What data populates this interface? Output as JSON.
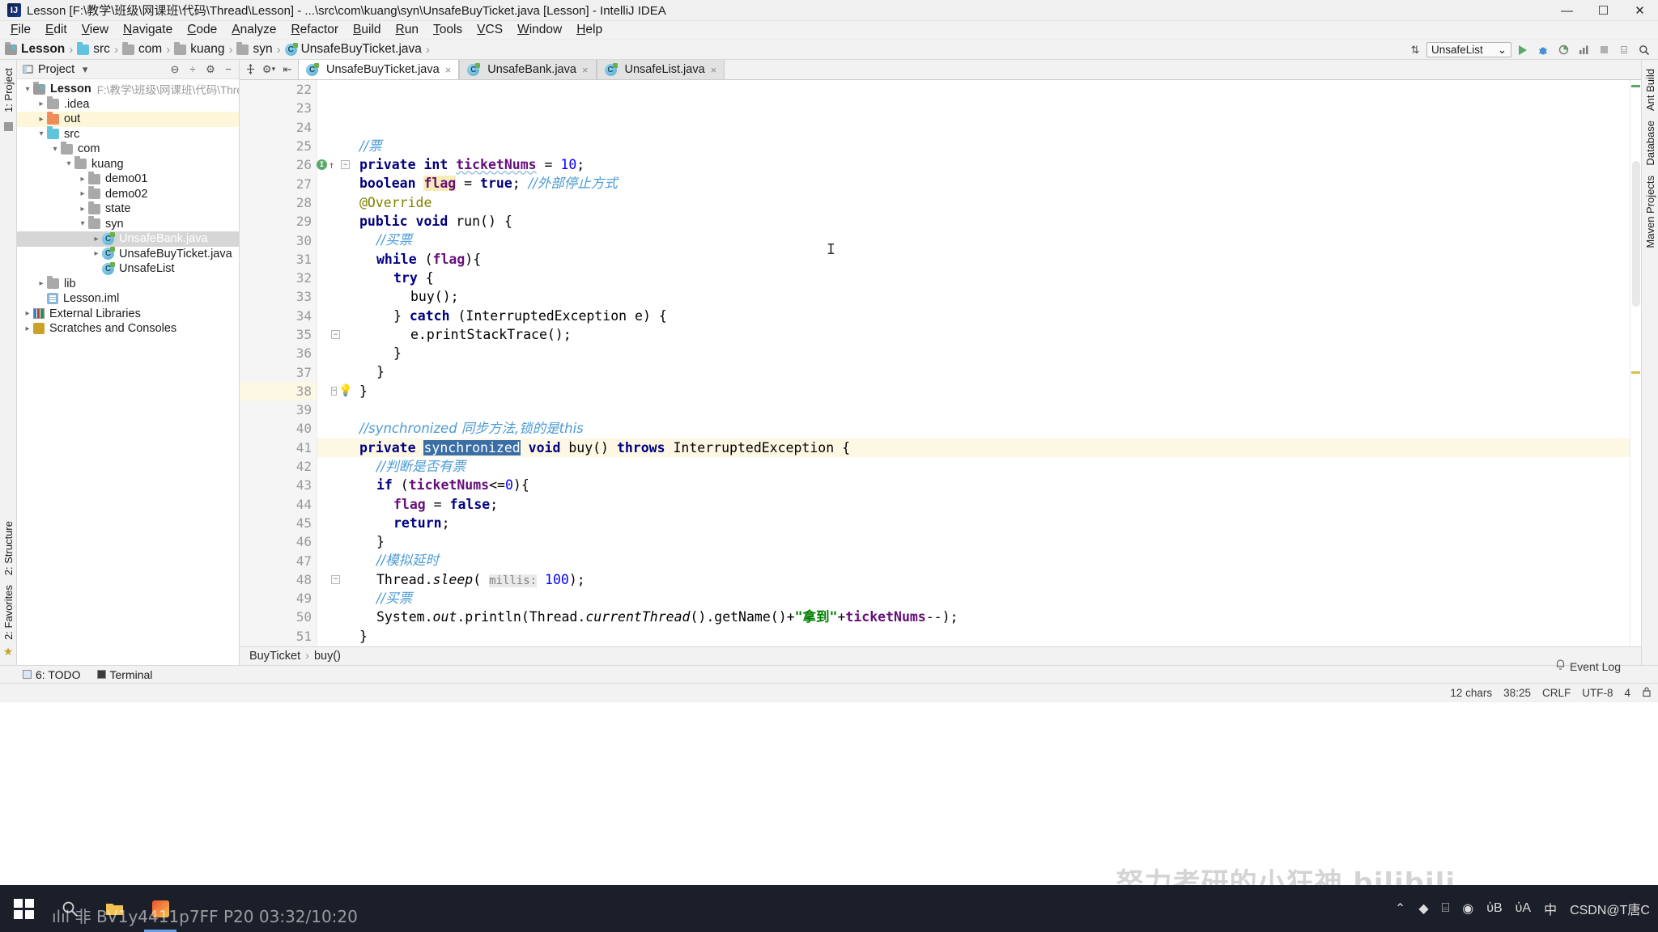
{
  "window": {
    "title": "Lesson [F:\\教学\\班级\\网课班\\代码\\Thread\\Lesson] - ...\\src\\com\\kuang\\syn\\UnsafeBuyTicket.java [Lesson] - IntelliJ IDEA",
    "logo_text": "IJ",
    "minimize": "—",
    "maximize": "☐",
    "close": "✕"
  },
  "menu": {
    "items": [
      "File",
      "Edit",
      "View",
      "Navigate",
      "Code",
      "Analyze",
      "Refactor",
      "Build",
      "Run",
      "Tools",
      "VCS",
      "Window",
      "Help"
    ]
  },
  "breadcrumb": {
    "items": [
      {
        "label": "Lesson",
        "icon": "module-icon"
      },
      {
        "label": "src",
        "icon": "source-folder-icon"
      },
      {
        "label": "com",
        "icon": "package-folder-icon"
      },
      {
        "label": "kuang",
        "icon": "package-folder-icon"
      },
      {
        "label": "syn",
        "icon": "package-folder-icon"
      },
      {
        "label": "UnsafeBuyTicket.java",
        "icon": "java-class-icon"
      }
    ],
    "separator": "›"
  },
  "nav_right": {
    "run_config": "UnsafeList",
    "dropdown_caret": "⌄",
    "update_icon": "⇅",
    "run_icon": "run-icon",
    "debug_icon": "⁂",
    "coverage_icon": "▶",
    "profiler_icon": "▦",
    "stop_icon": "■",
    "layout_icon": "⌸",
    "search_icon": "⌕"
  },
  "left_strip": {
    "project_tab": "1: Project",
    "structure_tab": "2: Structure",
    "favorites_tab": "2: Favorites"
  },
  "right_strip": {
    "ant_tab": "Ant Build",
    "database_tab": "Database",
    "maven_tab": "Maven Projects"
  },
  "project_panel": {
    "title": "Project",
    "caret": "▾",
    "collapse_icon": "⊖",
    "settings_icon": "⚙",
    "expand_icon": "÷",
    "hide_icon": "−",
    "tree": [
      {
        "label": "Lesson",
        "path": "F:\\教学\\班级\\网课班\\代码\\Thread\\Lesson",
        "depth": 0,
        "arrow": "open",
        "icon": "module-icon",
        "bold": true,
        "state": "normal"
      },
      {
        "label": ".idea",
        "depth": 1,
        "arrow": "closed",
        "icon": "folder-icon",
        "state": "normal"
      },
      {
        "label": "out",
        "depth": 1,
        "arrow": "closed",
        "icon": "out-folder-icon",
        "state": "highlight"
      },
      {
        "label": "src",
        "depth": 1,
        "arrow": "open",
        "icon": "source-folder-icon",
        "state": "normal"
      },
      {
        "label": "com",
        "depth": 2,
        "arrow": "open",
        "icon": "package-folder-icon",
        "state": "normal"
      },
      {
        "label": "kuang",
        "depth": 3,
        "arrow": "open",
        "icon": "package-folder-icon",
        "state": "normal"
      },
      {
        "label": "demo01",
        "depth": 4,
        "arrow": "closed",
        "icon": "package-folder-icon",
        "state": "normal"
      },
      {
        "label": "demo02",
        "depth": 4,
        "arrow": "closed",
        "icon": "package-folder-icon",
        "state": "normal"
      },
      {
        "label": "state",
        "depth": 4,
        "arrow": "closed",
        "icon": "package-folder-icon",
        "state": "normal"
      },
      {
        "label": "syn",
        "depth": 4,
        "arrow": "open",
        "icon": "package-folder-icon",
        "state": "normal"
      },
      {
        "label": "UnsafeBank.java",
        "depth": 5,
        "arrow": "closed",
        "icon": "java-class-icon",
        "state": "selected"
      },
      {
        "label": "UnsafeBuyTicket.java",
        "depth": 5,
        "arrow": "closed",
        "icon": "java-class-icon",
        "state": "normal"
      },
      {
        "label": "UnsafeList",
        "depth": 5,
        "arrow": "none",
        "icon": "java-class-icon",
        "state": "normal"
      },
      {
        "label": "lib",
        "depth": 1,
        "arrow": "closed",
        "icon": "folder-icon",
        "state": "normal"
      },
      {
        "label": "Lesson.iml",
        "depth": 1,
        "arrow": "none",
        "icon": "iml-icon",
        "state": "normal"
      },
      {
        "label": "External Libraries",
        "depth": 0,
        "arrow": "closed",
        "icon": "library-icon",
        "state": "normal"
      },
      {
        "label": "Scratches and Consoles",
        "depth": 0,
        "arrow": "closed",
        "icon": "scratch-icon",
        "state": "normal"
      }
    ]
  },
  "editor": {
    "tools": [
      "✢",
      "⚙",
      "⇤"
    ],
    "tabs": [
      {
        "label": "UnsafeBuyTicket.java",
        "active": true,
        "close": "×"
      },
      {
        "label": "UnsafeBank.java",
        "active": false,
        "close": "×"
      },
      {
        "label": "UnsafeList.java",
        "active": false,
        "close": "×"
      }
    ],
    "first_line_number": 22,
    "current_line": 38,
    "lines": [
      {
        "n": 22,
        "indent": 2,
        "tokens": [
          {
            "t": "//票",
            "c": "cmtc"
          }
        ]
      },
      {
        "n": 23,
        "indent": 2,
        "tokens": [
          {
            "t": "private",
            "c": "kw"
          },
          {
            "t": " ",
            "c": "plain"
          },
          {
            "t": "int",
            "c": "kw"
          },
          {
            "t": " ",
            "c": "plain"
          },
          {
            "t": "ticketNums",
            "c": "fld-wavy"
          },
          {
            "t": " = ",
            "c": "plain"
          },
          {
            "t": "10",
            "c": "num"
          },
          {
            "t": ";",
            "c": "plain"
          }
        ]
      },
      {
        "n": 24,
        "indent": 2,
        "tokens": [
          {
            "t": "boolean",
            "c": "kw"
          },
          {
            "t": " ",
            "c": "plain"
          },
          {
            "t": "flag",
            "c": "fld-hl"
          },
          {
            "t": " = ",
            "c": "plain"
          },
          {
            "t": "true",
            "c": "kw"
          },
          {
            "t": "; ",
            "c": "plain"
          },
          {
            "t": "//外部停止方式",
            "c": "cmtc"
          }
        ]
      },
      {
        "n": 25,
        "indent": 2,
        "tokens": [
          {
            "t": "@Override",
            "c": "ann"
          }
        ]
      },
      {
        "n": 26,
        "indent": 2,
        "tokens": [
          {
            "t": "public",
            "c": "kw"
          },
          {
            "t": " ",
            "c": "plain"
          },
          {
            "t": "void",
            "c": "kw"
          },
          {
            "t": " run() {",
            "c": "plain"
          }
        ],
        "mark": "run-gutter"
      },
      {
        "n": 27,
        "indent": 3,
        "tokens": [
          {
            "t": "//买票",
            "c": "cmtc"
          }
        ]
      },
      {
        "n": 28,
        "indent": 3,
        "tokens": [
          {
            "t": "while",
            "c": "kw"
          },
          {
            "t": " (",
            "c": "plain"
          },
          {
            "t": "flag",
            "c": "fld"
          },
          {
            "t": "){",
            "c": "plain"
          }
        ]
      },
      {
        "n": 29,
        "indent": 4,
        "tokens": [
          {
            "t": "try",
            "c": "kw"
          },
          {
            "t": " {",
            "c": "plain"
          }
        ]
      },
      {
        "n": 30,
        "indent": 5,
        "tokens": [
          {
            "t": "buy();",
            "c": "plain"
          }
        ]
      },
      {
        "n": 31,
        "indent": 4,
        "tokens": [
          {
            "t": "} ",
            "c": "plain"
          },
          {
            "t": "catch",
            "c": "kw"
          },
          {
            "t": " (InterruptedException e) {",
            "c": "plain"
          }
        ]
      },
      {
        "n": 32,
        "indent": 5,
        "tokens": [
          {
            "t": "e.printStackTrace();",
            "c": "plain"
          }
        ]
      },
      {
        "n": 33,
        "indent": 4,
        "tokens": [
          {
            "t": "}",
            "c": "plain"
          }
        ]
      },
      {
        "n": 34,
        "indent": 3,
        "tokens": [
          {
            "t": "}",
            "c": "plain"
          }
        ]
      },
      {
        "n": 35,
        "indent": 2,
        "tokens": [
          {
            "t": "}",
            "c": "plain"
          }
        ],
        "fold": true
      },
      {
        "n": 36,
        "indent": 0,
        "tokens": []
      },
      {
        "n": 37,
        "indent": 2,
        "tokens": [
          {
            "t": "//synchronized 同步方法,锁的是this",
            "c": "cmtc"
          }
        ]
      },
      {
        "n": 38,
        "indent": 2,
        "tokens": [
          {
            "t": "private",
            "c": "kw"
          },
          {
            "t": " ",
            "c": "plain"
          },
          {
            "t": "synchronized",
            "c": "sel"
          },
          {
            "t": " ",
            "c": "plain"
          },
          {
            "t": "void",
            "c": "kw"
          },
          {
            "t": " buy() ",
            "c": "plain"
          },
          {
            "t": "throws",
            "c": "kw"
          },
          {
            "t": " InterruptedException {",
            "c": "plain"
          }
        ],
        "fold": true,
        "bulb": true
      },
      {
        "n": 39,
        "indent": 3,
        "tokens": [
          {
            "t": "//判断是否有票",
            "c": "cmtc"
          }
        ]
      },
      {
        "n": 40,
        "indent": 3,
        "tokens": [
          {
            "t": "if",
            "c": "kw"
          },
          {
            "t": " (",
            "c": "plain"
          },
          {
            "t": "ticketNums",
            "c": "fld"
          },
          {
            "t": "<=",
            "c": "plain"
          },
          {
            "t": "0",
            "c": "num"
          },
          {
            "t": "){",
            "c": "plain"
          }
        ]
      },
      {
        "n": 41,
        "indent": 4,
        "tokens": [
          {
            "t": "flag",
            "c": "fld"
          },
          {
            "t": " = ",
            "c": "plain"
          },
          {
            "t": "false",
            "c": "kw"
          },
          {
            "t": ";",
            "c": "plain"
          }
        ]
      },
      {
        "n": 42,
        "indent": 4,
        "tokens": [
          {
            "t": "return",
            "c": "kw"
          },
          {
            "t": ";",
            "c": "plain"
          }
        ]
      },
      {
        "n": 43,
        "indent": 3,
        "tokens": [
          {
            "t": "}",
            "c": "plain"
          }
        ]
      },
      {
        "n": 44,
        "indent": 3,
        "tokens": [
          {
            "t": "//模拟延时",
            "c": "cmtc"
          }
        ]
      },
      {
        "n": 45,
        "indent": 3,
        "tokens": [
          {
            "t": "Thread.",
            "c": "plain"
          },
          {
            "t": "sleep",
            "c": "stat"
          },
          {
            "t": "( ",
            "c": "plain"
          },
          {
            "t": "millis:",
            "c": "param"
          },
          {
            "t": " ",
            "c": "plain"
          },
          {
            "t": "100",
            "c": "num"
          },
          {
            "t": ");",
            "c": "plain"
          }
        ]
      },
      {
        "n": 46,
        "indent": 3,
        "tokens": [
          {
            "t": "//买票",
            "c": "cmtc"
          }
        ]
      },
      {
        "n": 47,
        "indent": 3,
        "tokens": [
          {
            "t": "System.",
            "c": "plain"
          },
          {
            "t": "out",
            "c": "stat"
          },
          {
            "t": ".println(Thread.",
            "c": "plain"
          },
          {
            "t": "currentThread",
            "c": "stat"
          },
          {
            "t": "().getName()+",
            "c": "plain"
          },
          {
            "t": "\"拿到\"",
            "c": "str"
          },
          {
            "t": "+",
            "c": "plain"
          },
          {
            "t": "ticketNums",
            "c": "fld"
          },
          {
            "t": "--);",
            "c": "plain"
          }
        ]
      },
      {
        "n": 48,
        "indent": 2,
        "tokens": [
          {
            "t": "}",
            "c": "plain"
          }
        ],
        "fold": true
      },
      {
        "n": 49,
        "indent": 0,
        "tokens": []
      },
      {
        "n": 50,
        "indent": 0,
        "tokens": []
      },
      {
        "n": 51,
        "indent": 0,
        "tokens": [
          {
            "t": "}",
            "c": "plain"
          }
        ]
      }
    ],
    "footer_breadcrumb": [
      "BuyTicket",
      "buy()"
    ],
    "footer_sep": "›"
  },
  "bottom_tools": {
    "todo": "6: TODO",
    "terminal": "Terminal",
    "event_log": "Event Log"
  },
  "status_bar": {
    "chars": "12 chars",
    "position": "38:25",
    "line_sep": "CRLF",
    "encoding": "UTF-8",
    "indent": "4",
    "lock_icon": "⚇",
    "bell_icon": "⚇"
  },
  "watermark": "努力考研的小狂神 bilibili",
  "taskbar": {
    "overlay_text": "ılıl 非 BV1y4411p7FF  P20 03:32/10:20",
    "search_icon": "search-icon",
    "tray": [
      "⌃",
      "◆",
      "⌸",
      "◉",
      "ὐB",
      "ὐA",
      "中",
      "CSDN@T唐C"
    ],
    "tray_labels": [
      "show-hidden",
      "nvidia",
      "display",
      "opera",
      "battery",
      "volume",
      "ime",
      "csdn-watermark"
    ]
  },
  "colors": {
    "keyword": "#000080",
    "comment": "#4a9ad4",
    "field": "#660e7a",
    "string": "#008000",
    "number": "#0000ff",
    "selection": "#3a6ea5",
    "current_line": "#fcf8e4",
    "accent": "#59a869"
  }
}
